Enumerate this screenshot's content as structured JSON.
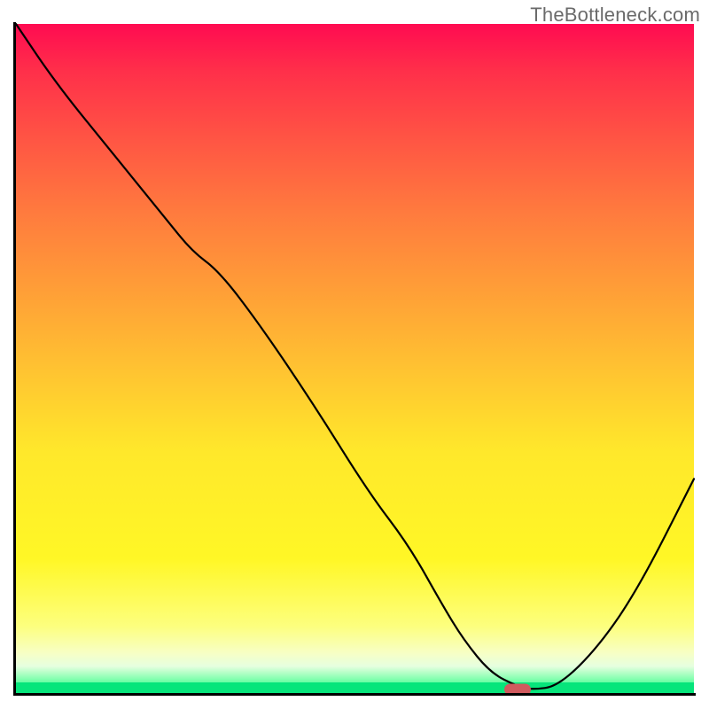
{
  "watermark": "TheBottleneck.com",
  "colors": {
    "gradient_top": "#ff0b51",
    "gradient_mid": "#ffe82b",
    "gradient_bottom": "#06e57b",
    "curve": "#000000",
    "axes": "#000000",
    "marker": "#d05a5e"
  },
  "chart_data": {
    "type": "line",
    "title": "",
    "xlabel": "",
    "ylabel": "",
    "xlim": [
      0,
      100
    ],
    "ylim": [
      0,
      100
    ],
    "grid": false,
    "legend": false,
    "x": [
      0,
      6,
      14,
      22,
      26,
      30,
      36,
      44,
      52,
      58,
      63,
      66,
      70,
      74,
      76,
      80,
      86,
      92,
      100
    ],
    "y": [
      100,
      91,
      81,
      71,
      66,
      63,
      55,
      43,
      30,
      22,
      13,
      8,
      3,
      1,
      0.5,
      1,
      7,
      16,
      32
    ],
    "annotations": [
      {
        "type": "flat-valley",
        "x_start": 69,
        "x_end": 76,
        "y": 0.5,
        "note": "curve bottoms out near zero"
      }
    ],
    "marker": {
      "shape": "pill",
      "x": 74,
      "y": 0.5,
      "color": "#d05a5e"
    }
  }
}
